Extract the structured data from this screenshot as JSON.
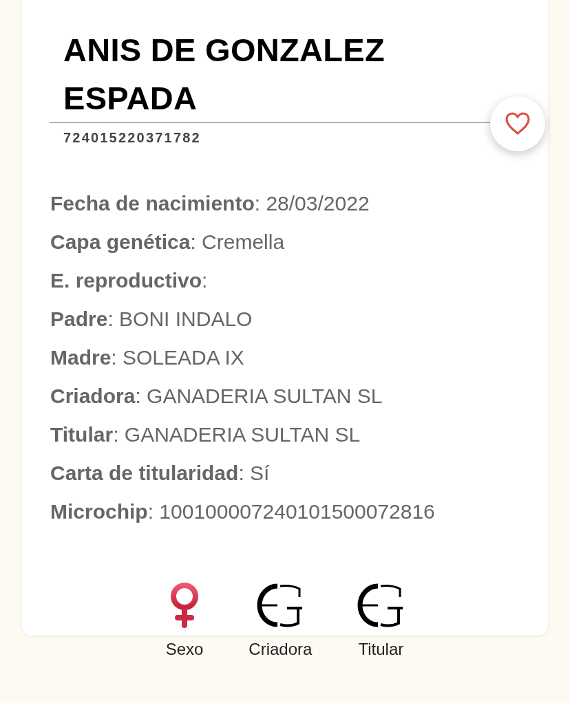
{
  "title": "ANIS DE GONZALEZ ESPADA",
  "favorite": {
    "on": false
  },
  "registration": "724015220371782",
  "details": [
    "**Fecha de nacimiento**: 28/03/2022",
    "**Capa genética**: Cremella",
    "**E. reproductivo**:",
    "**Padre**: BONI INDALO",
    "**Madre**: SOLEADA IX",
    "**Criadora**: GANADERIA SULTAN SL",
    "**Titular**: GANADERIA SULTAN SL",
    "**Carta de titularidad**: Sí",
    "**Microchip**: 100100007240101500072816"
  ],
  "badges": [
    {
      "kind": "female",
      "label": "Sexo"
    },
    {
      "kind": "logo",
      "label": "Criadora"
    },
    {
      "kind": "logo",
      "label": "Titular"
    }
  ]
}
